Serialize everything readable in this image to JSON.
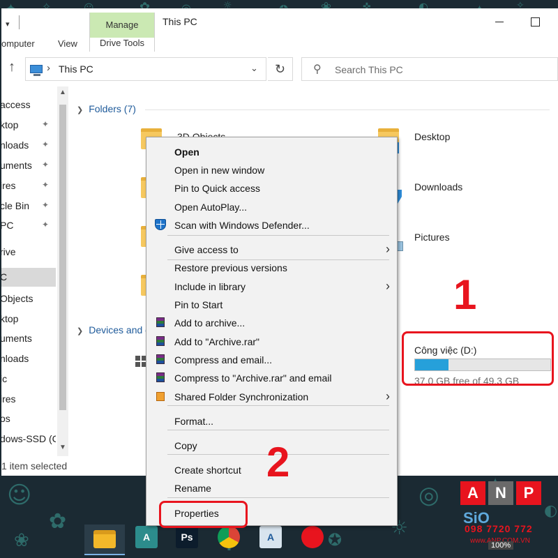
{
  "window": {
    "title": "This PC",
    "qat_arrow": "▾",
    "ribbon": {
      "tab_computer": "omputer",
      "tab_view": "View",
      "manage": "Manage",
      "drive_tools": "Drive Tools"
    }
  },
  "address": {
    "up": "↑",
    "separator": "›",
    "path": "This PC",
    "dropdown": "⌄",
    "refresh": "↻",
    "search_placeholder": "Search This PC"
  },
  "nav": {
    "items": [
      {
        "label": "access",
        "pinned": false
      },
      {
        "label": "ktop",
        "pinned": true
      },
      {
        "label": "nloads",
        "pinned": true
      },
      {
        "label": "uments",
        "pinned": true
      },
      {
        "label": "ires",
        "pinned": true
      },
      {
        "label": "cle Bin",
        "pinned": true
      },
      {
        "label": "PC",
        "pinned": true
      },
      {
        "label": "rive",
        "pinned": false
      },
      {
        "label": "C",
        "pinned": false
      },
      {
        "label": "Objects",
        "pinned": false
      },
      {
        "label": "ktop",
        "pinned": false
      },
      {
        "label": "uments",
        "pinned": false
      },
      {
        "label": "nloads",
        "pinned": false
      },
      {
        "label": "ic",
        "pinned": false
      },
      {
        "label": "ires",
        "pinned": false
      },
      {
        "label": "os",
        "pinned": false
      },
      {
        "label": "dows-SSD (C",
        "pinned": false
      }
    ],
    "pin_glyph": "📌"
  },
  "content": {
    "folders_header": "Folders (7)",
    "devices_header": "Devices and d",
    "folders": [
      "3D Objects",
      "Desktop",
      "Downloads",
      "Pictures"
    ],
    "drive": {
      "name": "Công việc (D:)",
      "free_text": "37.0 GB free of 49.3 GB",
      "used_fraction": 0.249
    }
  },
  "status": {
    "text": "1 item selected"
  },
  "context_menu": {
    "items": [
      {
        "label": "Open",
        "bold": true,
        "submenu": false,
        "icon": null
      },
      {
        "label": "Open in new window",
        "bold": false,
        "submenu": false,
        "icon": null
      },
      {
        "label": "Pin to Quick access",
        "bold": false,
        "submenu": false,
        "icon": null
      },
      {
        "label": "Open AutoPlay...",
        "bold": false,
        "submenu": false,
        "icon": null
      },
      {
        "label": "Scan with Windows Defender...",
        "bold": false,
        "submenu": false,
        "icon": "shield-icon"
      },
      {
        "label": "Give access to",
        "bold": false,
        "submenu": true,
        "icon": null
      },
      {
        "label": "Restore previous versions",
        "bold": false,
        "submenu": false,
        "icon": null
      },
      {
        "label": "Include in library",
        "bold": false,
        "submenu": true,
        "icon": null
      },
      {
        "label": "Pin to Start",
        "bold": false,
        "submenu": false,
        "icon": null
      },
      {
        "label": "Add to archive...",
        "bold": false,
        "submenu": false,
        "icon": "winrar-icon"
      },
      {
        "label": "Add to \"Archive.rar\"",
        "bold": false,
        "submenu": false,
        "icon": "winrar-icon"
      },
      {
        "label": "Compress and email...",
        "bold": false,
        "submenu": false,
        "icon": "winrar-icon"
      },
      {
        "label": "Compress to \"Archive.rar\" and email",
        "bold": false,
        "submenu": false,
        "icon": "winrar-icon"
      },
      {
        "label": "Shared Folder Synchronization",
        "bold": false,
        "submenu": true,
        "icon": "sync-icon"
      },
      {
        "label": "Format...",
        "bold": false,
        "submenu": false,
        "icon": null
      },
      {
        "label": "Copy",
        "bold": false,
        "submenu": false,
        "icon": null
      },
      {
        "label": "Create shortcut",
        "bold": false,
        "submenu": false,
        "icon": null
      },
      {
        "label": "Rename",
        "bold": false,
        "submenu": false,
        "icon": null
      },
      {
        "label": "Properties",
        "bold": false,
        "submenu": false,
        "icon": null
      }
    ],
    "submenu_arrow": "›"
  },
  "annotations": {
    "step1": "1",
    "step2": "2",
    "highlight_color": "#e8141e"
  },
  "taskbar": {
    "apps": [
      {
        "name": "file-explorer-icon",
        "glyph": "",
        "color": "#f3b82a"
      },
      {
        "name": "autocad-architecture-icon",
        "glyph": "A",
        "color": "#2c8c8c"
      },
      {
        "name": "photoshop-icon",
        "glyph": "Ps",
        "color": "#0c1c2c"
      },
      {
        "name": "chrome-icon",
        "glyph": "",
        "color": "#dd4b39"
      },
      {
        "name": "autocad-icon",
        "glyph": "A",
        "color": "#d8e4ee"
      },
      {
        "name": "garena-icon",
        "glyph": "",
        "color": "#e8141e"
      }
    ]
  },
  "watermark": {
    "letters": [
      "A",
      "N",
      "P"
    ],
    "brand": "SiO",
    "phone": "098 7720 772",
    "site": "www.ANP.COM.VN",
    "zoom": "100%"
  }
}
